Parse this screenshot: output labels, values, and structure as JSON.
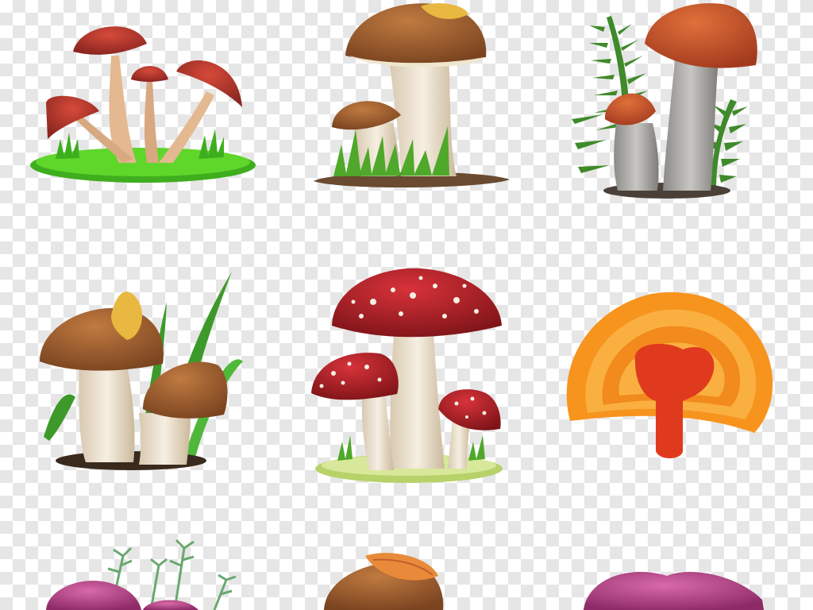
{
  "canvas": {
    "background": "transparency-checkerboard",
    "checker_colors": [
      "#ffffff",
      "#e6e6e6"
    ]
  },
  "illustrations": [
    {
      "name": "brown-cap-mushroom-cluster-on-grass",
      "cap_color": "#a83a2e"
    },
    {
      "name": "porcini-mushrooms-with-leaf",
      "cap_color": "#9a5a2c"
    },
    {
      "name": "orange-cap-birch-boletes-with-ferns",
      "cap_color": "#c8502a"
    },
    {
      "name": "brown-boletes-with-grass-and-leaf",
      "cap_color": "#8a5226"
    },
    {
      "name": "red-fly-agaric-mushrooms",
      "cap_color": "#b3202a"
    },
    {
      "name": "orange-lingzhi-bracket-fungus",
      "cap_color": "#f07a1a"
    },
    {
      "name": "pink-mushroom-with-moss-partial",
      "cap_color": "#b53a8a"
    },
    {
      "name": "tan-mushroom-with-leaf-partial",
      "cap_color": "#c08040"
    },
    {
      "name": "magenta-mushroom-partial",
      "cap_color": "#b5407e"
    }
  ]
}
